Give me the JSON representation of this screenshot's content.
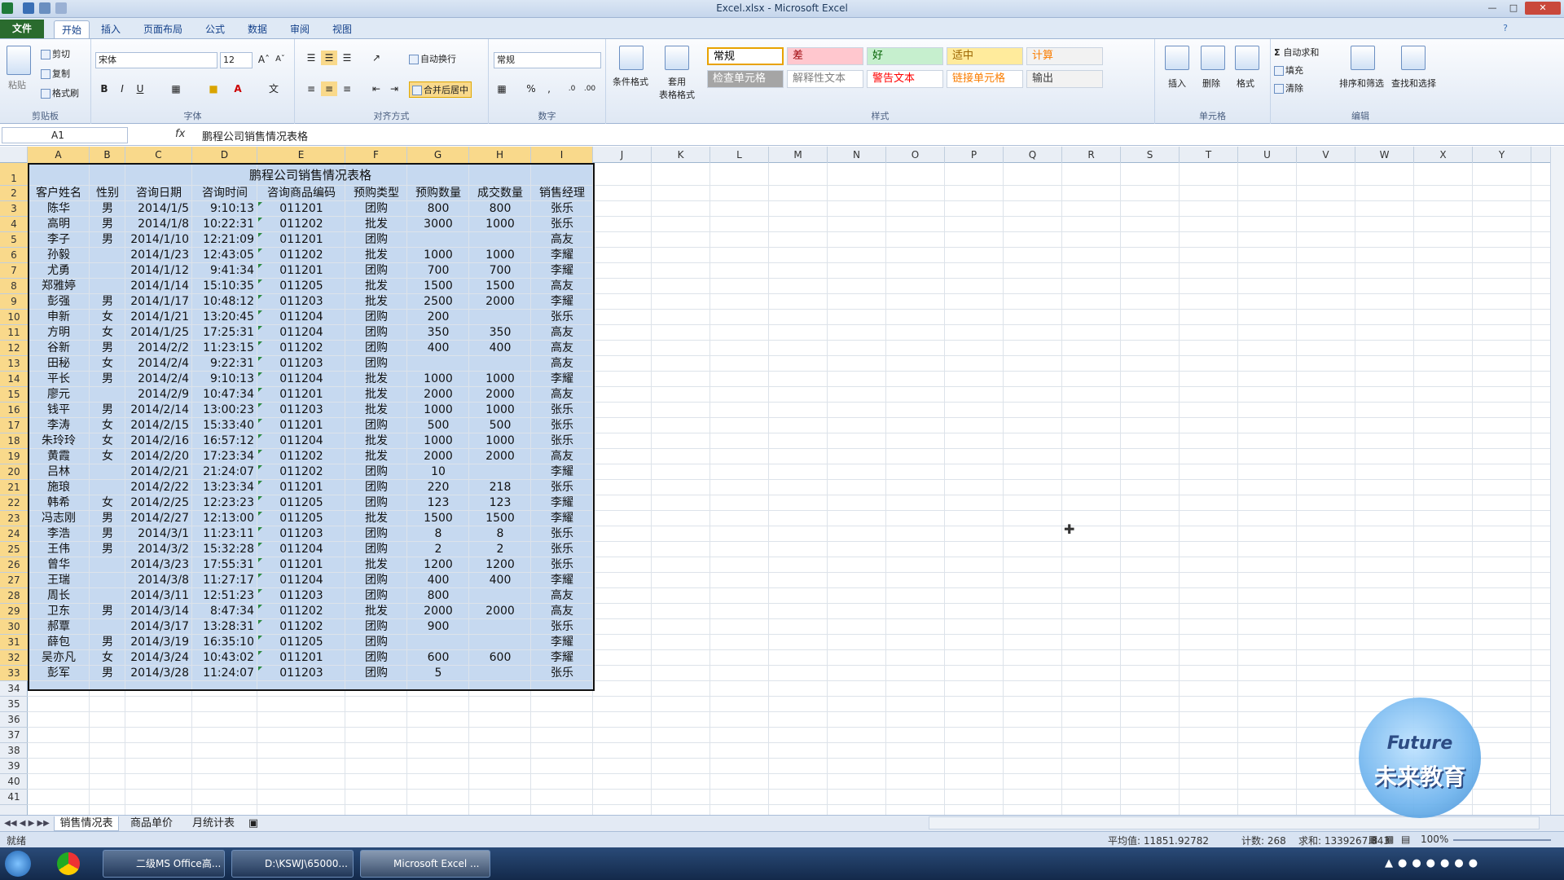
{
  "window": {
    "title": "Excel.xlsx - Microsoft Excel"
  },
  "tabs": [
    "文件",
    "开始",
    "插入",
    "页面布局",
    "公式",
    "数据",
    "审阅",
    "视图"
  ],
  "ribbon": {
    "clipboard": {
      "paste": "粘贴",
      "cut": "剪切",
      "copy": "复制",
      "format_painter": "格式刷",
      "name": "剪贴板"
    },
    "font": {
      "family": "宋体",
      "size": "12",
      "bold": "B",
      "italic": "I",
      "underline": "U",
      "name": "字体"
    },
    "alignment": {
      "wrap": "自动换行",
      "merge": "合并后居中",
      "name": "对齐方式"
    },
    "number": {
      "format": "常规",
      "percent": "%",
      "comma": ",",
      "name": "数字"
    },
    "styles": {
      "conditional": "条件格式",
      "table": "套用\n表格格式",
      "name": "样式",
      "items": [
        {
          "label": "常规",
          "bg": "#ffffff",
          "fg": "#000000"
        },
        {
          "label": "差",
          "bg": "#ffc7ce",
          "fg": "#9c0006"
        },
        {
          "label": "好",
          "bg": "#c6efce",
          "fg": "#006100"
        },
        {
          "label": "适中",
          "bg": "#ffeb9c",
          "fg": "#9c6500"
        },
        {
          "label": "计算",
          "bg": "#f2f2f2",
          "fg": "#fa7d00"
        },
        {
          "label": "检查单元格",
          "bg": "#a5a5a5",
          "fg": "#ffffff"
        },
        {
          "label": "解释性文本",
          "bg": "#ffffff",
          "fg": "#7f7f7f"
        },
        {
          "label": "警告文本",
          "bg": "#ffffff",
          "fg": "#ff0000"
        },
        {
          "label": "链接单元格",
          "bg": "#ffffff",
          "fg": "#fa7d00"
        },
        {
          "label": "输出",
          "bg": "#f2f2f2",
          "fg": "#3f3f3f"
        }
      ]
    },
    "cells": {
      "insert": "插入",
      "delete": "删除",
      "format": "格式",
      "name": "单元格"
    },
    "editing": {
      "autosum": "自动求和",
      "fill": "填充",
      "clear": "清除",
      "sort": "排序和筛选",
      "find": "查找和选择",
      "name": "编辑"
    }
  },
  "formula_bar": {
    "name_box": "A1",
    "fx": "fx",
    "content": "鹏程公司销售情况表格"
  },
  "columns": [
    "A",
    "B",
    "C",
    "D",
    "E",
    "F",
    "G",
    "H",
    "I",
    "J",
    "K",
    "L",
    "M",
    "N",
    "O",
    "P",
    "Q",
    "R",
    "S",
    "T",
    "U",
    "V",
    "W",
    "X",
    "Y"
  ],
  "sheet": {
    "title": "鹏程公司销售情况表格",
    "headers": [
      "客户姓名",
      "性别",
      "咨询日期",
      "咨询时间",
      "咨询商品编码",
      "预购类型",
      "预购数量",
      "成交数量",
      "销售经理"
    ],
    "rows": [
      [
        "陈华",
        "男",
        "2014/1/5",
        "9:10:13",
        "011201",
        "团购",
        "800",
        "800",
        "张乐"
      ],
      [
        "高明",
        "男",
        "2014/1/8",
        "10:22:31",
        "011202",
        "批发",
        "3000",
        "1000",
        "张乐"
      ],
      [
        "李子",
        "男",
        "2014/1/10",
        "12:21:09",
        "011201",
        "团购",
        "",
        "",
        "高友"
      ],
      [
        "孙毅",
        "",
        "2014/1/23",
        "12:43:05",
        "011202",
        "批发",
        "1000",
        "1000",
        "李耀"
      ],
      [
        "尤勇",
        "",
        "2014/1/12",
        "9:41:34",
        "011201",
        "团购",
        "700",
        "700",
        "李耀"
      ],
      [
        "郑雅婷",
        "",
        "2014/1/14",
        "15:10:35",
        "011205",
        "批发",
        "1500",
        "1500",
        "高友"
      ],
      [
        "彭强",
        "男",
        "2014/1/17",
        "10:48:12",
        "011203",
        "批发",
        "2500",
        "2000",
        "李耀"
      ],
      [
        "申新",
        "女",
        "2014/1/21",
        "13:20:45",
        "011204",
        "团购",
        "200",
        "",
        "张乐"
      ],
      [
        "方明",
        "女",
        "2014/1/25",
        "17:25:31",
        "011204",
        "团购",
        "350",
        "350",
        "高友"
      ],
      [
        "谷新",
        "男",
        "2014/2/2",
        "11:23:15",
        "011202",
        "团购",
        "400",
        "400",
        "高友"
      ],
      [
        "田秘",
        "女",
        "2014/2/4",
        "9:22:31",
        "011203",
        "团购",
        "",
        "",
        "高友"
      ],
      [
        "平长",
        "男",
        "2014/2/4",
        "9:10:13",
        "011204",
        "批发",
        "1000",
        "1000",
        "李耀"
      ],
      [
        "廖元",
        "",
        "2014/2/9",
        "10:47:34",
        "011201",
        "批发",
        "2000",
        "2000",
        "高友"
      ],
      [
        "钱平",
        "男",
        "2014/2/14",
        "13:00:23",
        "011203",
        "批发",
        "1000",
        "1000",
        "张乐"
      ],
      [
        "李涛",
        "女",
        "2014/2/15",
        "15:33:40",
        "011201",
        "团购",
        "500",
        "500",
        "张乐"
      ],
      [
        "朱玲玲",
        "女",
        "2014/2/16",
        "16:57:12",
        "011204",
        "批发",
        "1000",
        "1000",
        "张乐"
      ],
      [
        "黄霞",
        "女",
        "2014/2/20",
        "17:23:34",
        "011202",
        "批发",
        "2000",
        "2000",
        "高友"
      ],
      [
        "吕林",
        "",
        "2014/2/21",
        "21:24:07",
        "011202",
        "团购",
        "10",
        "",
        "李耀"
      ],
      [
        "施琅",
        "",
        "2014/2/22",
        "13:23:34",
        "011201",
        "团购",
        "220",
        "218",
        "张乐"
      ],
      [
        "韩希",
        "女",
        "2014/2/25",
        "12:23:23",
        "011205",
        "团购",
        "123",
        "123",
        "李耀"
      ],
      [
        "冯志刚",
        "男",
        "2014/2/27",
        "12:13:00",
        "011205",
        "批发",
        "1500",
        "1500",
        "李耀"
      ],
      [
        "李浩",
        "男",
        "2014/3/1",
        "11:23:11",
        "011203",
        "团购",
        "8",
        "8",
        "张乐"
      ],
      [
        "王伟",
        "男",
        "2014/3/2",
        "15:32:28",
        "011204",
        "团购",
        "2",
        "2",
        "张乐"
      ],
      [
        "曾华",
        "",
        "2014/3/23",
        "17:55:31",
        "011201",
        "批发",
        "1200",
        "1200",
        "张乐"
      ],
      [
        "王瑞",
        "",
        "2014/3/8",
        "11:27:17",
        "011204",
        "团购",
        "400",
        "400",
        "李耀"
      ],
      [
        "周长",
        "",
        "2014/3/11",
        "12:51:23",
        "011203",
        "团购",
        "800",
        "",
        "高友"
      ],
      [
        "卫东",
        "男",
        "2014/3/14",
        "8:47:34",
        "011202",
        "批发",
        "2000",
        "2000",
        "高友"
      ],
      [
        "郝覃",
        "",
        "2014/3/17",
        "13:28:31",
        "011202",
        "团购",
        "900",
        "",
        "张乐"
      ],
      [
        "薛包",
        "男",
        "2014/3/19",
        "16:35:10",
        "011205",
        "团购",
        "",
        "",
        "李耀"
      ],
      [
        "吴亦凡",
        "女",
        "2014/3/24",
        "10:43:02",
        "011201",
        "团购",
        "600",
        "600",
        "李耀"
      ],
      [
        "彭军",
        "男",
        "2014/3/28",
        "11:24:07",
        "011203",
        "团购",
        "5",
        "",
        "张乐"
      ]
    ]
  },
  "sheet_tabs": [
    "销售情况表",
    "商品单价",
    "月统计表"
  ],
  "status": {
    "ready": "就绪",
    "average": "平均值: 11851.92782",
    "count": "计数: 268",
    "sum": "求和: 1339267.843",
    "zoom": "100%"
  },
  "logo": {
    "line1": "Future",
    "line2": "未来教育"
  },
  "taskbar": {
    "items": [
      "二级MS Office高...",
      "D:\\KSWJ\\65000...",
      "Microsoft Excel ..."
    ]
  },
  "colors": {
    "selection": "#c6d9f0",
    "header_sel": "#f9d98b",
    "file_tab": "#2a6b2e"
  }
}
